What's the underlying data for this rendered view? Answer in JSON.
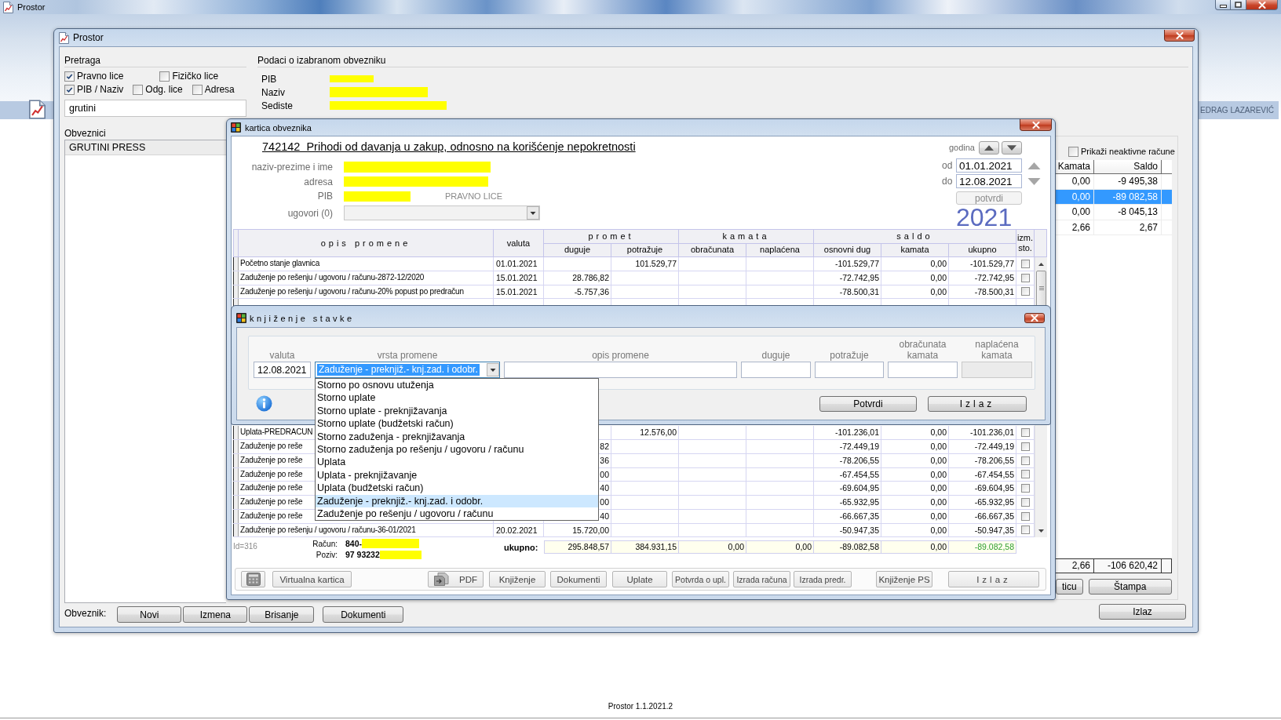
{
  "app": {
    "title": "Prostor",
    "user": "EDRAG LAZAREVIĆ",
    "version": "Prostor 1.1.2021.2"
  },
  "main_window": {
    "title": "Prostor",
    "search": {
      "title": "Pretraga",
      "option_rows": [
        [
          {
            "label": "Pravno lice",
            "checked": true
          },
          {
            "label": "Fizičko lice",
            "checked": false
          }
        ],
        [
          {
            "label": "PIB / Naziv",
            "checked": true
          },
          {
            "label": "Odg. lice",
            "checked": false
          },
          {
            "label": "Adresa",
            "checked": false
          }
        ]
      ],
      "value": "grutini"
    },
    "taxpayers": {
      "title": "Obveznici",
      "items": [
        {
          "label": "GRUTINI PRESS",
          "selected": true
        }
      ]
    },
    "details": {
      "title": "Podaci o izabranom obvezniku",
      "fields": [
        {
          "label": "PIB"
        },
        {
          "label": "Naziv"
        },
        {
          "label": "Sediste"
        }
      ]
    },
    "accounts": {
      "show_inactive": {
        "label": "Prikaži neaktivne račune",
        "checked": false
      },
      "columns": [
        "Kamata",
        "Saldo"
      ],
      "rows": [
        {
          "cells": [
            "0,00",
            "-9 495,38"
          ],
          "selected": false
        },
        {
          "cells": [
            "0,00",
            "-89 082,58"
          ],
          "selected": true
        },
        {
          "cells": [
            "0,00",
            "-8 045,13"
          ],
          "selected": false
        },
        {
          "cells": [
            "2,66",
            "2,67"
          ],
          "selected": false
        }
      ],
      "totals": [
        "2,66",
        "-106 620,42"
      ],
      "buttons": [
        "ticu",
        "Štampa"
      ]
    },
    "footer": {
      "label": "Obveznik:",
      "buttons": [
        "Novi",
        "Izmena",
        "Brisanje",
        "Dokumenti"
      ],
      "exit": "Izlaz"
    }
  },
  "card_window": {
    "title": "kartica obveznika",
    "heading": "742142  Prihodi od davanja u zakup, odnosno na korišćenje nepokretnosti",
    "fields": [
      {
        "label": "naziv-prezime i ime"
      },
      {
        "label": "adresa"
      },
      {
        "label": "PIB",
        "note": "PRAVNO LICE"
      }
    ],
    "contracts": {
      "label": "ugovori (0)",
      "disabled": true
    },
    "period": {
      "year_label": "godina",
      "from_label": "od",
      "from": "01.01.2021",
      "to_label": "do",
      "to": "12.08.2021",
      "confirm": {
        "label": "potvrdi",
        "disabled": true
      },
      "year": "2021"
    },
    "table": {
      "header": [
        {
          "label": "opis promene"
        },
        {
          "label": "valuta"
        },
        {
          "label": "promet",
          "columns": [
            "duguje",
            "potražuje"
          ]
        },
        {
          "label": "kamata",
          "columns": [
            "obračunata",
            "naplaćena"
          ]
        },
        {
          "label": "saldo",
          "columns": [
            "osnovni dug",
            "kamata",
            "ukupno"
          ]
        },
        {
          "label": "izm. sto."
        }
      ],
      "rows": [
        {
          "description": "Početno stanje glavnica",
          "value_date": "01.01.2021",
          "credit": "101.529,77",
          "principal_balance": "-101.529,77",
          "interest_balance": "0,00",
          "total_balance": "-101.529,77",
          "checked": false
        },
        {
          "description": "Zaduženje po rešenju / ugovoru / računu-2872-12/2020",
          "value_date": "15.01.2021",
          "debit": "28.786,82",
          "principal_balance": "-72.742,95",
          "interest_balance": "0,00",
          "total_balance": "-72.742,95",
          "checked": false
        },
        {
          "description": "Zaduženje po rešenju / ugovoru / računu-20% popust po predračun",
          "value_date": "15.01.2021",
          "debit": "-5.757,36",
          "principal_balance": "-78.500,31",
          "interest_balance": "0,00",
          "total_balance": "-78.500,31",
          "checked": false
        },
        {
          "description": "Uplata-PREDRACUN",
          "credit": "12.576,00",
          "principal_balance": "-101.236,01",
          "interest_balance": "0,00",
          "total_balance": "-101.236,01",
          "checked": false
        },
        {
          "description": "Zaduženje po reše",
          "debit": "82",
          "principal_balance": "-72.449,19",
          "interest_balance": "0,00",
          "total_balance": "-72.449,19",
          "checked": false
        },
        {
          "description": "Zaduženje po reše",
          "debit": "36",
          "principal_balance": "-78.206,55",
          "interest_balance": "0,00",
          "total_balance": "-78.206,55",
          "checked": false
        },
        {
          "description": "Zaduženje po reše",
          "debit": "00",
          "principal_balance": "-67.454,55",
          "interest_balance": "0,00",
          "total_balance": "-67.454,55",
          "checked": false
        },
        {
          "description": "Zaduženje po reše",
          "debit": "40",
          "principal_balance": "-69.604,95",
          "interest_balance": "0,00",
          "total_balance": "-69.604,95",
          "checked": false
        },
        {
          "description": "Zaduženje po reše",
          "debit": "00",
          "principal_balance": "-65.932,95",
          "interest_balance": "0,00",
          "total_balance": "-65.932,95",
          "checked": false
        },
        {
          "description": "Zaduženje po reše",
          "debit": "40",
          "principal_balance": "-66.667,35",
          "interest_balance": "0,00",
          "total_balance": "-66.667,35",
          "checked": false
        },
        {
          "description": "Zaduženje po rešenju / ugovoru / računu-36-01/2021",
          "value_date": "20.02.2021",
          "debit": "15.720,00",
          "principal_balance": "-50.947,35",
          "interest_balance": "0,00",
          "total_balance": "-50.947,35",
          "checked": false
        }
      ]
    },
    "summary": {
      "id": "Id=316",
      "account_label": "Račun:",
      "account": "840-",
      "reference_label": "Poziv:",
      "reference": "97 93232",
      "total_label": "ukupno:",
      "totals": {
        "debit": "295.848,57",
        "credit": "384.931,15",
        "interest_charged": "0,00",
        "interest_paid": "0,00",
        "principal_balance": "-89.082,58",
        "interest_balance": "0,00",
        "total_balance": "-89.082,58"
      }
    },
    "toolbar": [
      {
        "kind": "icon"
      },
      {
        "kind": "text",
        "label": "Virtualna kartica"
      },
      {
        "kind": "icon_text",
        "label": "PDF"
      },
      {
        "kind": "text",
        "label": "Knjiženje"
      },
      {
        "kind": "text",
        "label": "Dokumenti"
      },
      {
        "kind": "text",
        "label": "Uplate"
      },
      {
        "kind": "text",
        "label": "Potvrda o upl."
      },
      {
        "kind": "text",
        "label": "Izrada računa"
      },
      {
        "kind": "text",
        "label": "Izrada predr."
      },
      {
        "kind": "text",
        "label": "Knjiženje PS"
      },
      {
        "kind": "text",
        "label": "Izlaz"
      }
    ]
  },
  "entry_dialog": {
    "title": "knjiženje stavke",
    "fields": [
      {
        "kind": "text",
        "label": "valuta",
        "value": "12.08.2021",
        "disabled": false
      },
      {
        "kind": "combo",
        "label": "vrsta promene",
        "value": "Zaduženje - preknjiž.- knj.zad. i odobr.",
        "disabled": false,
        "expanded": true,
        "options": [
          {
            "label": "Storno po osnovu utuženja",
            "selected": false
          },
          {
            "label": "Storno uplate",
            "selected": false
          },
          {
            "label": "Storno uplate - preknjižavanja",
            "selected": false
          },
          {
            "label": "Storno uplate (budžetski račun)",
            "selected": false
          },
          {
            "label": "Storno zaduženja - preknjižavanja",
            "selected": false
          },
          {
            "label": "Storno zaduženja po rešenju / ugovoru / računu",
            "selected": false
          },
          {
            "label": "Uplata",
            "selected": false
          },
          {
            "label": "Uplata - preknjižavanje",
            "selected": false
          },
          {
            "label": "Uplata (budžetski račun)",
            "selected": false
          },
          {
            "label": "Zaduženje - preknjiž.- knj.zad. i odobr.",
            "selected": true
          },
          {
            "label": "Zaduženje po rešenju / ugovoru / računu",
            "selected": false
          }
        ]
      },
      {
        "kind": "text",
        "label": "opis promene",
        "disabled": false
      },
      {
        "kind": "text",
        "label": "duguje",
        "disabled": false
      },
      {
        "kind": "text",
        "label": "potražuje",
        "disabled": false
      },
      {
        "kind": "text",
        "label": "obračunata kamata",
        "disabled": false
      },
      {
        "kind": "text",
        "label": "naplaćena kamata",
        "disabled": true
      }
    ],
    "buttons": [
      "Potvrdi",
      "Izlaz"
    ]
  }
}
